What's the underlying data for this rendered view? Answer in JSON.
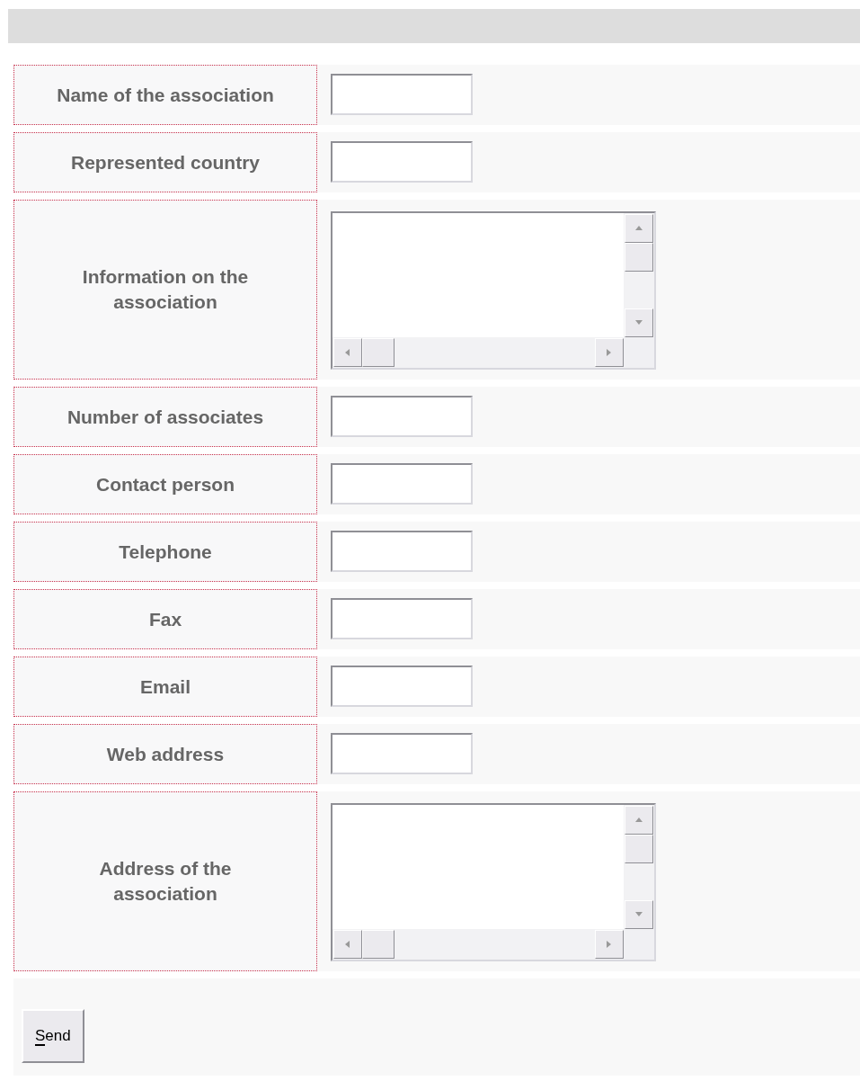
{
  "fields": [
    {
      "label": "Name of the association",
      "kind": "text"
    },
    {
      "label": "Represented country",
      "kind": "text"
    },
    {
      "label": "Information on the association",
      "kind": "textarea"
    },
    {
      "label": "Number of associates",
      "kind": "text"
    },
    {
      "label": "Contact person",
      "kind": "text"
    },
    {
      "label": "Telephone",
      "kind": "text"
    },
    {
      "label": "Fax",
      "kind": "text"
    },
    {
      "label": "Email",
      "kind": "text"
    },
    {
      "label": "Web address",
      "kind": "text"
    },
    {
      "label": "Address of the association",
      "kind": "textarea"
    }
  ],
  "submit": {
    "label": "Send"
  }
}
